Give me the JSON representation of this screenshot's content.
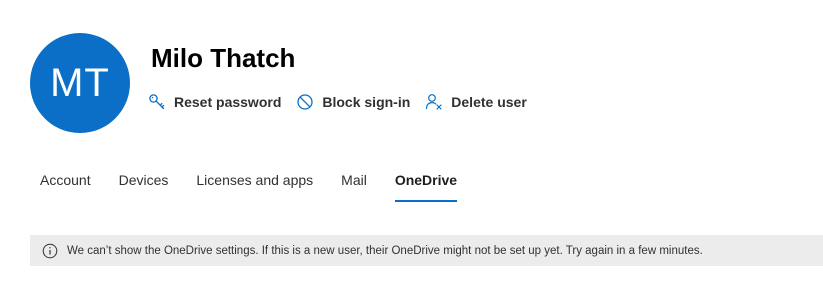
{
  "user": {
    "initials": "MT",
    "name": "Milo Thatch",
    "avatar_color": "#0b6fc7"
  },
  "actions": [
    {
      "label": "Reset password",
      "icon": "key-icon"
    },
    {
      "label": "Block sign-in",
      "icon": "block-icon"
    },
    {
      "label": "Delete user",
      "icon": "delete-user-icon"
    }
  ],
  "tabs": [
    {
      "label": "Account",
      "active": false
    },
    {
      "label": "Devices",
      "active": false
    },
    {
      "label": "Licenses and apps",
      "active": false
    },
    {
      "label": "Mail",
      "active": false
    },
    {
      "label": "OneDrive",
      "active": true
    }
  ],
  "notice": {
    "icon": "info-icon",
    "text": "We can’t show the OneDrive settings. If this is a new user, their OneDrive might not be set up yet. Try again in a few minutes."
  },
  "colors": {
    "accent": "#0b6fc7",
    "notice_background": "#ececec"
  }
}
